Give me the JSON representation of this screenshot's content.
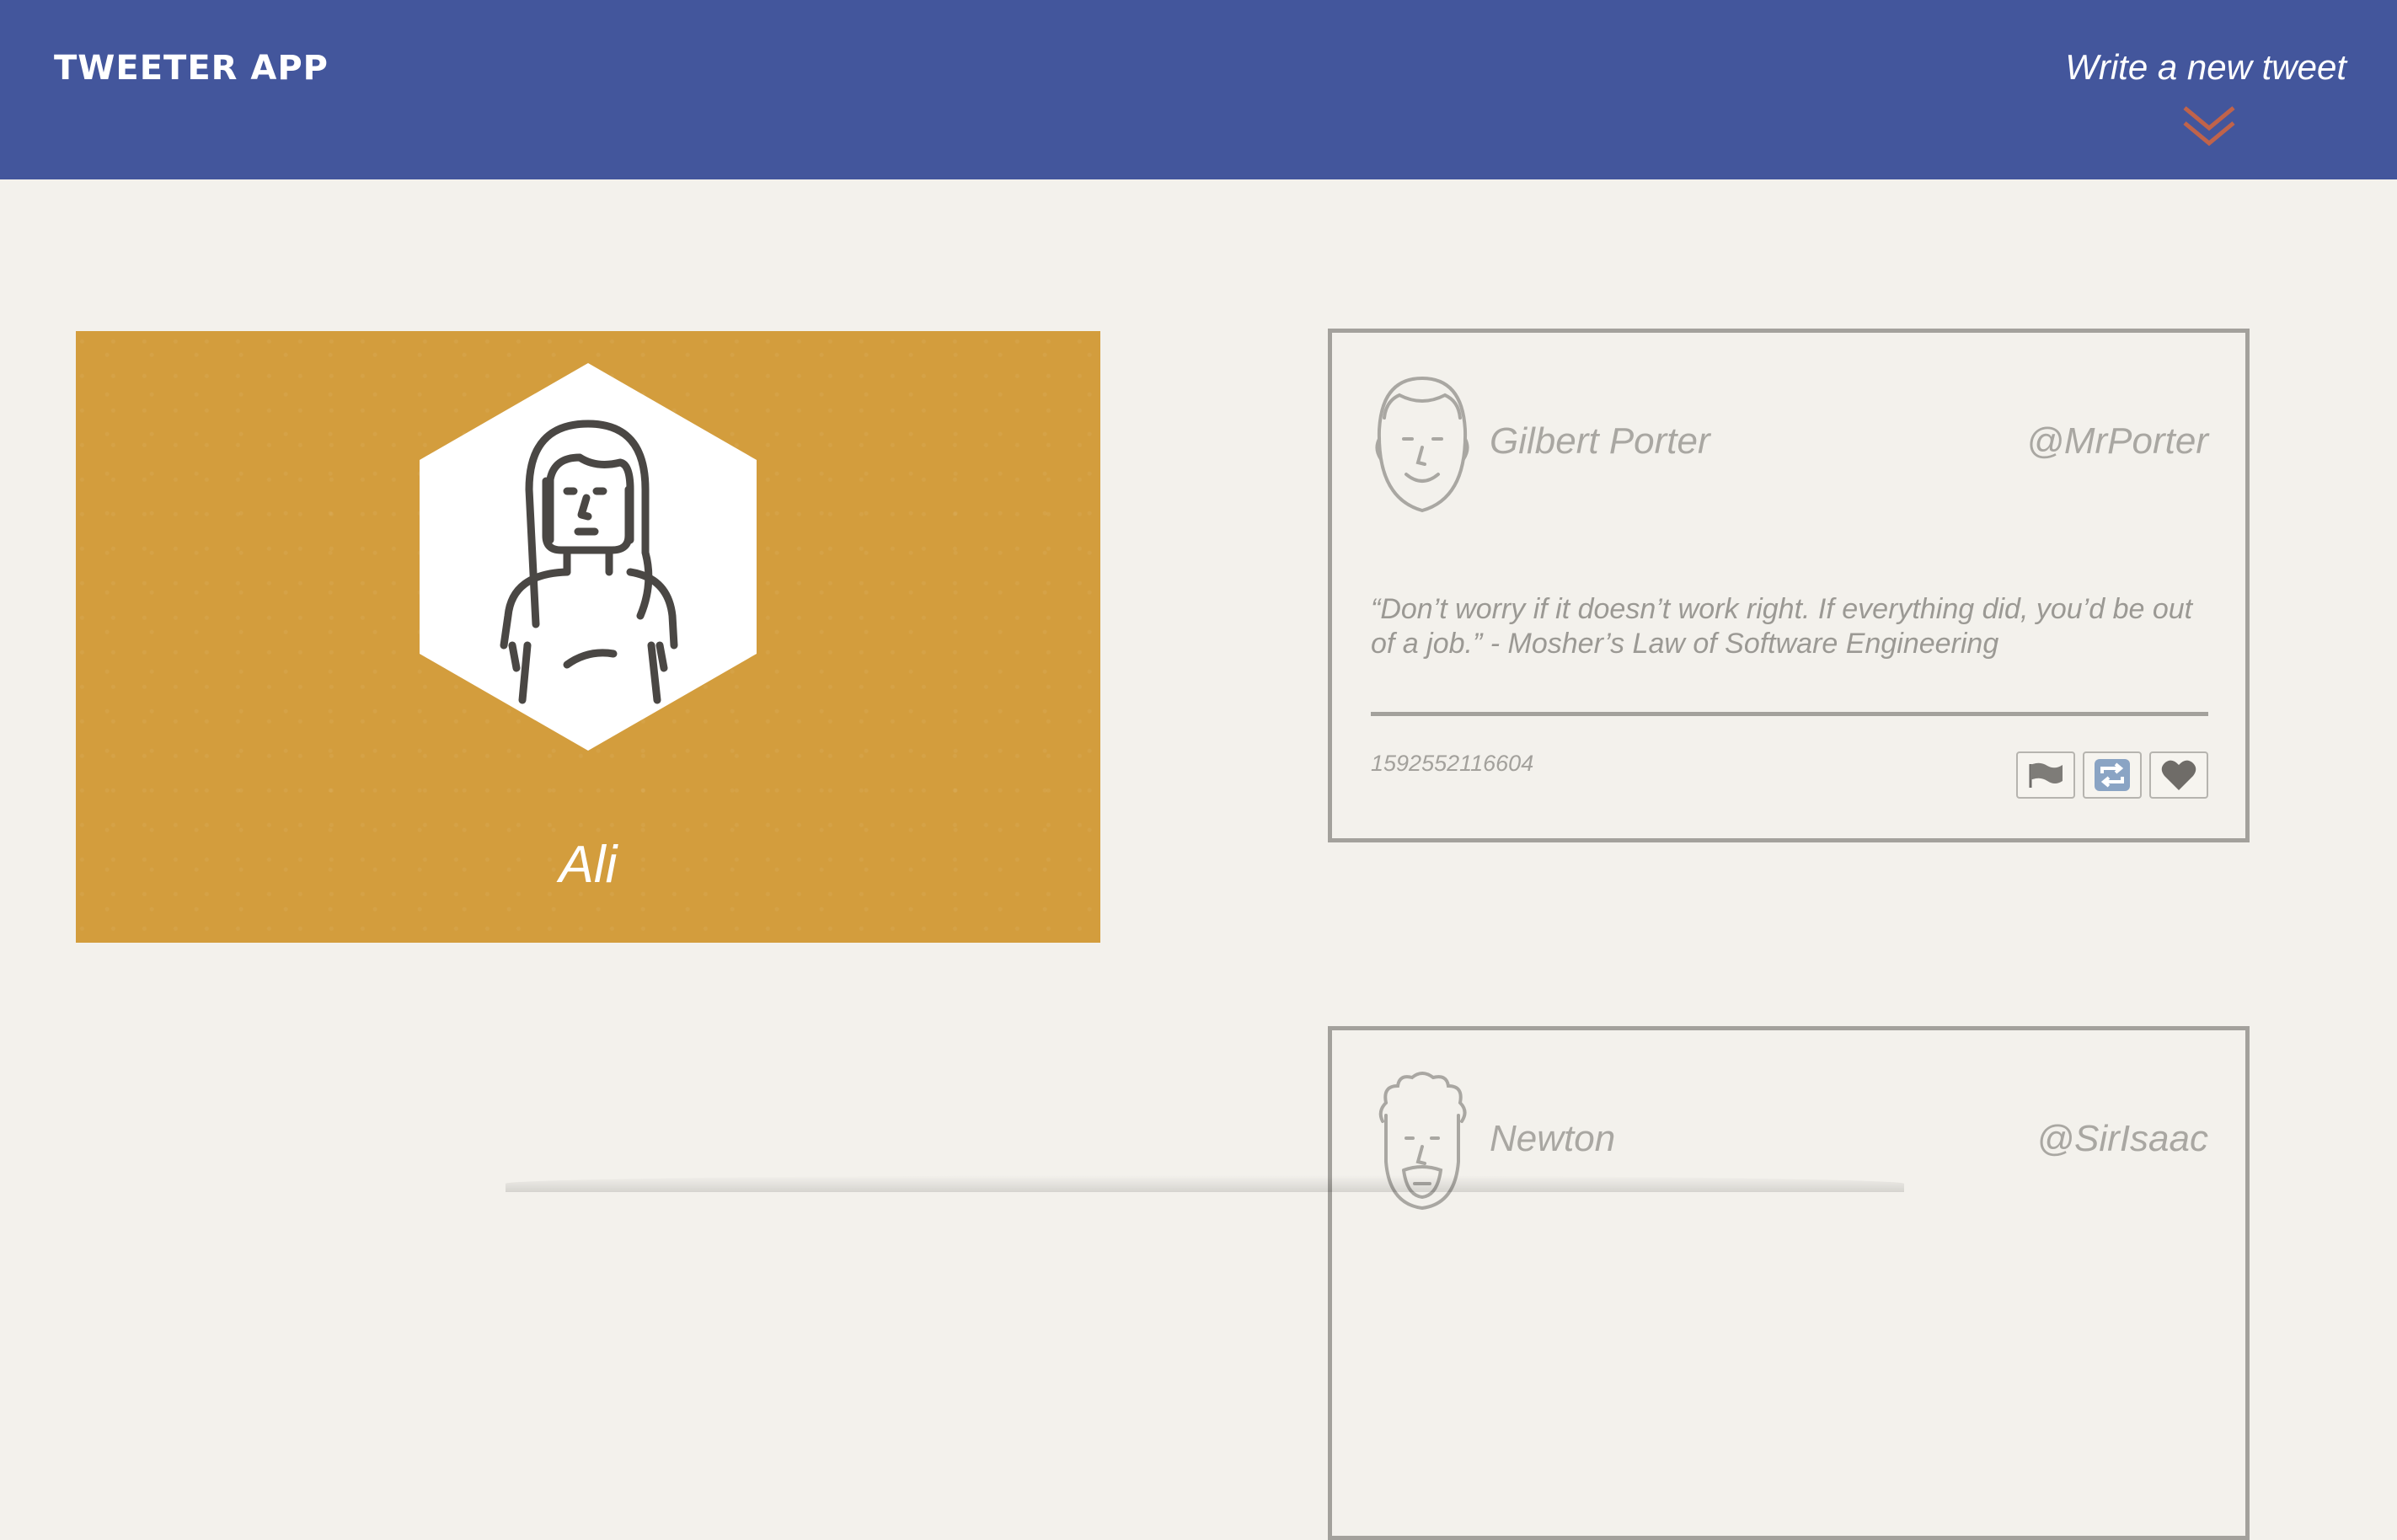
{
  "app": {
    "brand": "TWEETER APP",
    "compose_label": "Write a new tweet"
  },
  "colors": {
    "nav_bg": "#43569c",
    "accent_chevron": "#c0634a",
    "profile_bg": "#d39d3d",
    "page_bg": "#f3f1ec"
  },
  "profile": {
    "name": "Ali",
    "avatar_icon": "female-avatar-icon"
  },
  "tweets": [
    {
      "user": "Gilbert Porter",
      "handle": "@MrPorter",
      "avatar_icon": "bald-man-avatar-icon",
      "body": "“Don’t worry if it doesn’t work right. If everything did, you’d be out of a job.” - Mosher’s Law of Software Engineering",
      "timestamp": "1592552116604",
      "actions": [
        "flag-icon",
        "retweet-icon",
        "heart-icon"
      ]
    },
    {
      "user": "Newton",
      "handle": "@SirIsaac",
      "avatar_icon": "curly-hair-avatar-icon"
    }
  ]
}
